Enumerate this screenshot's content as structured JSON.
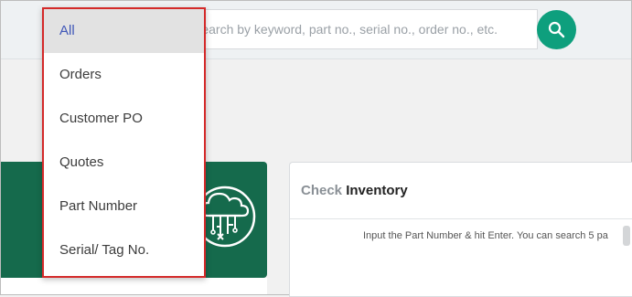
{
  "search": {
    "placeholder": "Search by keyword, part no., serial no., order no., etc.",
    "button_icon": "search-icon",
    "button_color": "#0e9f7d"
  },
  "dropdown": {
    "selected": "All",
    "options": [
      "All",
      "Orders",
      "Customer PO",
      "Quotes",
      "Part Number",
      "Serial/ Tag No."
    ],
    "highlight_color": "#d42a2a"
  },
  "banner": {
    "color": "#156a4c",
    "icon": "cloud-network-icon"
  },
  "inventory": {
    "title_muted": "Check",
    "title_strong": "Inventory",
    "hint": "Input the Part Number & hit Enter. You can search 5 pa"
  }
}
